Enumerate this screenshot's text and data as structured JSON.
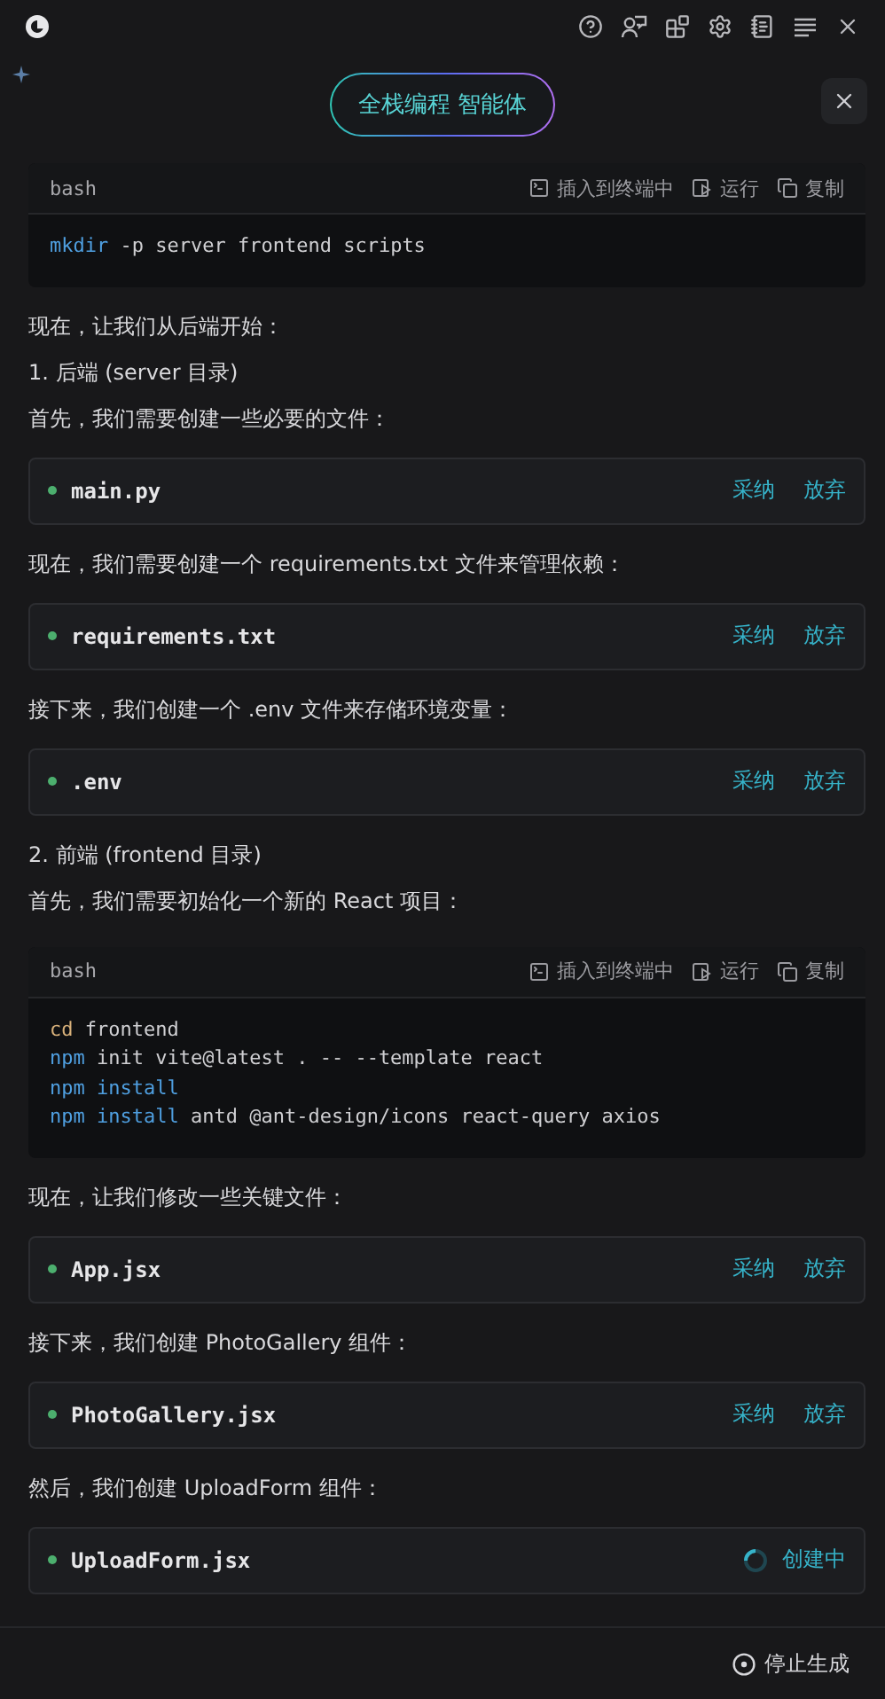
{
  "banner": {
    "title": "全栈编程 智能体"
  },
  "content": [
    {
      "kind": "code",
      "language": "bash",
      "actions": [
        "插入到终端中",
        "运行",
        "复制"
      ],
      "lines": [
        [
          {
            "kind": "command",
            "text": "mkdir"
          },
          {
            "kind": "plain",
            "text": " -p server frontend scripts"
          }
        ]
      ]
    },
    {
      "kind": "text",
      "text": "现在，让我们从后端开始："
    },
    {
      "kind": "text",
      "text": "1. 后端 (server 目录)"
    },
    {
      "kind": "text",
      "text": "首先，我们需要创建一些必要的文件："
    },
    {
      "kind": "file",
      "name": "main.py",
      "creating": false,
      "actions": [
        "采纳",
        "放弃"
      ]
    },
    {
      "kind": "text",
      "text": "现在，我们需要创建一个 requirements.txt 文件来管理依赖："
    },
    {
      "kind": "file",
      "name": "requirements.txt",
      "creating": false,
      "actions": [
        "采纳",
        "放弃"
      ]
    },
    {
      "kind": "text",
      "text": "接下来，我们创建一个 .env 文件来存储环境变量："
    },
    {
      "kind": "file",
      "name": ".env",
      "creating": false,
      "actions": [
        "采纳",
        "放弃"
      ]
    },
    {
      "kind": "text",
      "text": "2. 前端 (frontend 目录)"
    },
    {
      "kind": "text",
      "text": "首先，我们需要初始化一个新的 React 项目："
    },
    {
      "kind": "code",
      "language": "bash",
      "actions": [
        "插入到终端中",
        "运行",
        "复制"
      ],
      "lines": [
        [
          {
            "kind": "builtin",
            "text": "cd"
          },
          {
            "kind": "plain",
            "text": " frontend"
          }
        ],
        [
          {
            "kind": "command",
            "text": "npm"
          },
          {
            "kind": "plain",
            "text": " init vite@latest . -- --template react"
          }
        ],
        [
          {
            "kind": "command",
            "text": "npm install"
          }
        ],
        [
          {
            "kind": "command",
            "text": "npm install"
          },
          {
            "kind": "plain",
            "text": " antd @ant-design/icons react-query axios"
          }
        ]
      ]
    },
    {
      "kind": "text",
      "text": "现在，让我们修改一些关键文件："
    },
    {
      "kind": "file",
      "name": "App.jsx",
      "creating": false,
      "actions": [
        "采纳",
        "放弃"
      ]
    },
    {
      "kind": "text",
      "text": "接下来，我们创建 PhotoGallery 组件："
    },
    {
      "kind": "file",
      "name": "PhotoGallery.jsx",
      "creating": false,
      "actions": [
        "采纳",
        "放弃"
      ]
    },
    {
      "kind": "text",
      "text": "然后，我们创建 UploadForm 组件："
    },
    {
      "kind": "file",
      "name": "UploadForm.jsx",
      "creating": true,
      "label": "创建中"
    }
  ],
  "footer": {
    "stop_button": "停止生成"
  }
}
